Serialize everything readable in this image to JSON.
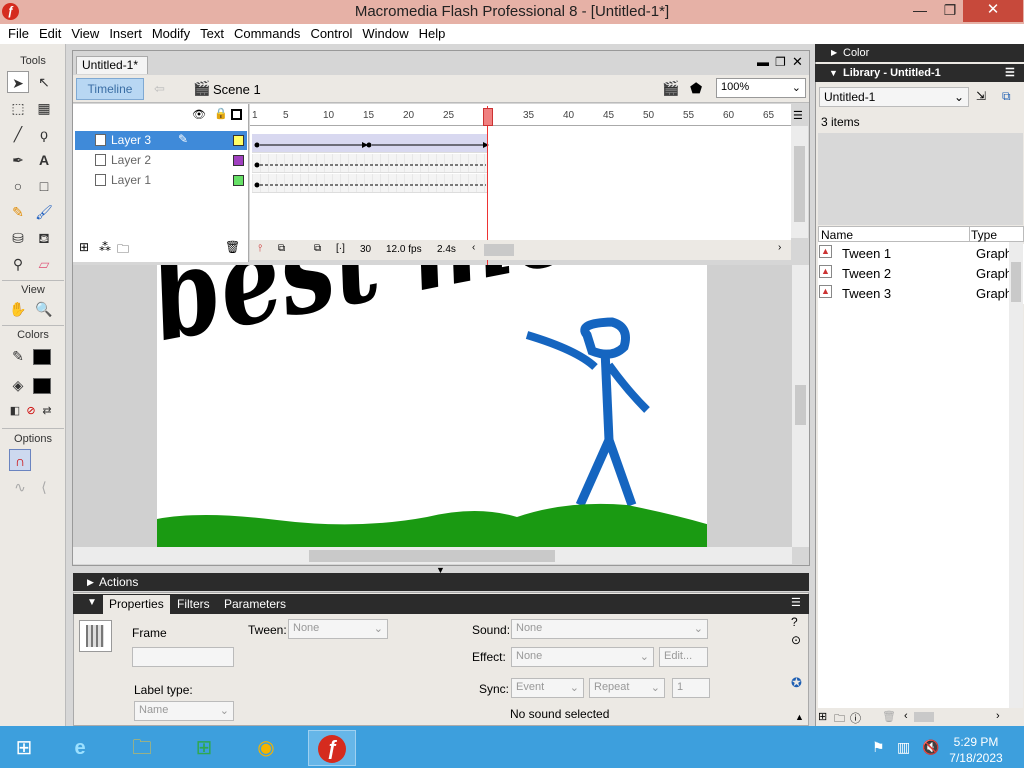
{
  "window": {
    "title": "Macromedia Flash Professional 8 - [Untitled-1*]",
    "min": "—",
    "max": "❐",
    "close": "✕"
  },
  "menu": [
    "File",
    "Edit",
    "View",
    "Insert",
    "Modify",
    "Text",
    "Commands",
    "Control",
    "Window",
    "Help"
  ],
  "tools": {
    "header": "Tools",
    "view": "View",
    "colors": "Colors",
    "options": "Options"
  },
  "document": {
    "tab": "Untitled-1*",
    "timeline_btn": "Timeline",
    "scene": "Scene 1",
    "zoom": "100%"
  },
  "layers": [
    {
      "name": "Layer 3",
      "color": "#ffff66"
    },
    {
      "name": "Layer 2",
      "color": "#a040c0"
    },
    {
      "name": "Layer 1",
      "color": "#66e066"
    }
  ],
  "ruler": [
    "1",
    "5",
    "10",
    "15",
    "20",
    "25",
    "30",
    "35",
    "40",
    "45",
    "50",
    "55",
    "60",
    "65"
  ],
  "timeline_footer": {
    "frame": "30",
    "fps": "12.0 fps",
    "time": "2.4s"
  },
  "stage_text": "best movie ever!!!",
  "actions_label": "Actions",
  "props": {
    "tabs": [
      "Properties",
      "Filters",
      "Parameters"
    ],
    "frame_label": "Frame",
    "tween_label": "Tween:",
    "tween_value": "None",
    "sound_label": "Sound:",
    "sound_value": "None",
    "effect_label": "Effect:",
    "effect_value": "None",
    "edit_btn": "Edit...",
    "label_type": "Label type:",
    "label_type_value": "Name",
    "sync_label": "Sync:",
    "sync_value": "Event",
    "repeat_value": "Repeat",
    "repeat_count": "1",
    "no_sound": "No sound selected"
  },
  "right_panel": {
    "color_hdr": "Color",
    "library_hdr": "Library - Untitled-1",
    "lib_select": "Untitled-1",
    "items_count": "3 items",
    "col_name": "Name",
    "col_type": "Type",
    "items": [
      {
        "name": "Tween 1",
        "type": "Graph"
      },
      {
        "name": "Tween 2",
        "type": "Graph"
      },
      {
        "name": "Tween 3",
        "type": "Graph"
      }
    ]
  },
  "taskbar": {
    "time": "5:29 PM",
    "date": "7/18/2023"
  }
}
